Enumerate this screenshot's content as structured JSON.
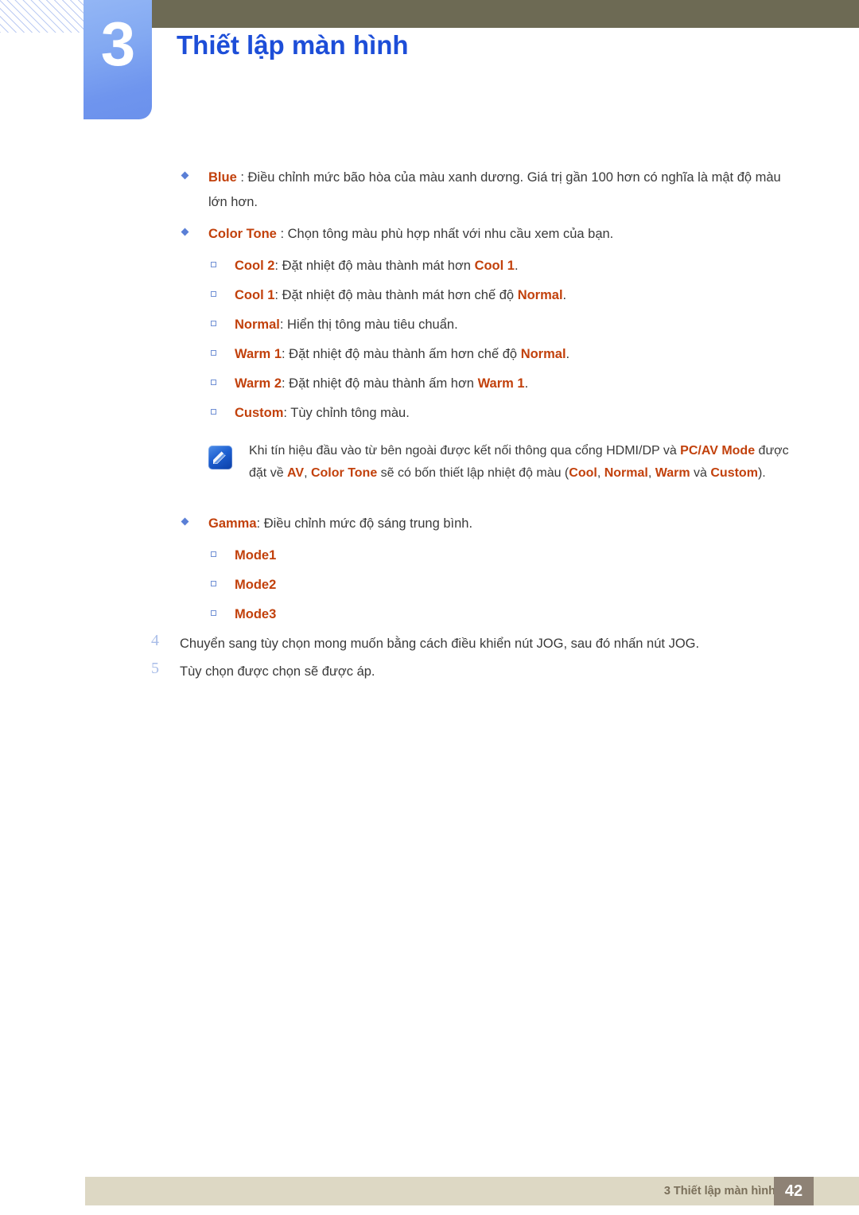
{
  "header": {
    "chapter_number": "3",
    "title": "Thiết lập màn hình",
    "bar_color": "#6d6a54",
    "chapter_block_color": "#83a9f2",
    "title_color": "#1d4ed8"
  },
  "colors": {
    "keyword": "#c2410c",
    "body_text": "#3a3a3a",
    "bullet": "#5a7fd6",
    "step_number": "#a9bde8",
    "footer_bg": "#ddd8c4",
    "footer_page_bg": "#8e8275",
    "footer_text": "#7a6f5a"
  },
  "bullets": [
    {
      "id": "blue",
      "parts": [
        {
          "t": "Blue",
          "kw": true
        },
        {
          "t": " : Điều chỉnh mức bão hòa của màu xanh dương. Giá trị gần 100 hơn có nghĩa là mật độ màu lớn hơn.",
          "kw": false
        }
      ]
    },
    {
      "id": "color-tone",
      "parts": [
        {
          "t": "Color Tone",
          "kw": true
        },
        {
          "t": " : Chọn tông màu phù hợp nhất với nhu cầu xem của bạn.",
          "kw": false
        }
      ]
    }
  ],
  "color_tone_options": [
    {
      "id": "cool-2",
      "parts": [
        {
          "t": "Cool 2",
          "kw": true
        },
        {
          "t": ": Đặt nhiệt độ màu thành mát hơn ",
          "kw": false
        },
        {
          "t": "Cool 1",
          "kw": true
        },
        {
          "t": ".",
          "kw": false
        }
      ]
    },
    {
      "id": "cool-1",
      "parts": [
        {
          "t": "Cool 1",
          "kw": true
        },
        {
          "t": ": Đặt nhiệt độ màu thành mát hơn chế độ ",
          "kw": false
        },
        {
          "t": "Normal",
          "kw": true
        },
        {
          "t": ".",
          "kw": false
        }
      ]
    },
    {
      "id": "normal",
      "parts": [
        {
          "t": "Normal",
          "kw": true
        },
        {
          "t": ": Hiển thị tông màu tiêu chuẩn.",
          "kw": false
        }
      ]
    },
    {
      "id": "warm-1",
      "parts": [
        {
          "t": "Warm 1",
          "kw": true
        },
        {
          "t": ": Đặt nhiệt độ màu thành ấm hơn chế độ ",
          "kw": false
        },
        {
          "t": "Normal",
          "kw": true
        },
        {
          "t": ".",
          "kw": false
        }
      ]
    },
    {
      "id": "warm-2",
      "parts": [
        {
          "t": "Warm 2",
          "kw": true
        },
        {
          "t": ": Đặt nhiệt độ màu thành ấm hơn ",
          "kw": false
        },
        {
          "t": "Warm 1",
          "kw": true
        },
        {
          "t": ".",
          "kw": false
        }
      ]
    },
    {
      "id": "custom",
      "parts": [
        {
          "t": "Custom",
          "kw": true
        },
        {
          "t": ": Tùy chỉnh tông màu.",
          "kw": false
        }
      ]
    }
  ],
  "note": {
    "icon_name": "note-pencil-icon",
    "parts": [
      {
        "t": "Khi tín hiệu đầu vào từ bên ngoài được kết nối thông qua cổng HDMI/DP và ",
        "kw": false
      },
      {
        "t": "PC/AV Mode",
        "kw": true
      },
      {
        "t": " được đặt về ",
        "kw": false
      },
      {
        "t": "AV",
        "kw": true
      },
      {
        "t": ", ",
        "kw": false
      },
      {
        "t": "Color Tone",
        "kw": true
      },
      {
        "t": " sẽ có bốn thiết lập nhiệt độ màu (",
        "kw": false
      },
      {
        "t": "Cool",
        "kw": true
      },
      {
        "t": ", ",
        "kw": false
      },
      {
        "t": "Normal",
        "kw": true
      },
      {
        "t": ", ",
        "kw": false
      },
      {
        "t": "Warm",
        "kw": true
      },
      {
        "t": " và ",
        "kw": false
      },
      {
        "t": "Custom",
        "kw": true
      },
      {
        "t": ").",
        "kw": false
      }
    ]
  },
  "gamma_bullet": {
    "id": "gamma",
    "parts": [
      {
        "t": "Gamma",
        "kw": true
      },
      {
        "t": ": Điều chỉnh mức độ sáng trung bình.",
        "kw": false
      }
    ]
  },
  "gamma_options": [
    {
      "id": "mode1",
      "parts": [
        {
          "t": "Mode1",
          "kw": true
        }
      ]
    },
    {
      "id": "mode2",
      "parts": [
        {
          "t": "Mode2",
          "kw": true
        }
      ]
    },
    {
      "id": "mode3",
      "parts": [
        {
          "t": "Mode3",
          "kw": true
        }
      ]
    }
  ],
  "steps": [
    {
      "num": "4",
      "text": "Chuyển sang tùy chọn mong muốn bằng cách điều khiển nút JOG, sau đó nhấn nút JOG."
    },
    {
      "num": "5",
      "text": "Tùy chọn được chọn sẽ được áp."
    }
  ],
  "footer": {
    "label": "3 Thiết lập màn hình",
    "page_number": "42"
  }
}
